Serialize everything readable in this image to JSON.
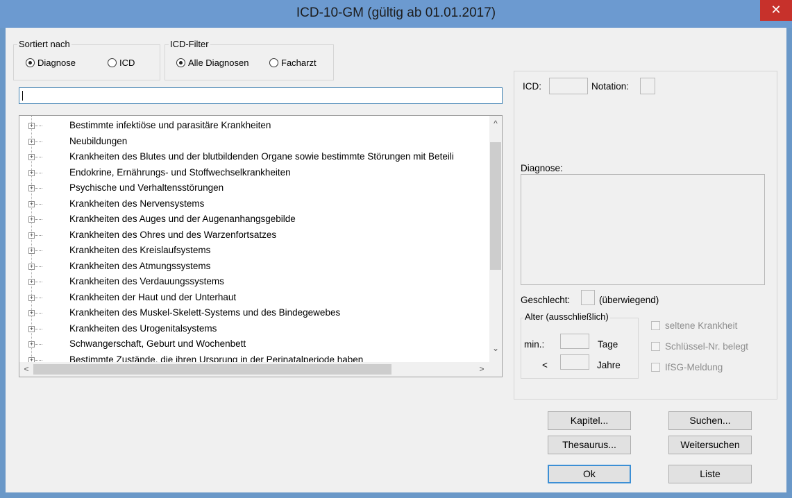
{
  "window": {
    "title": "ICD-10-GM (gültig ab 01.01.2017)",
    "close_glyph": "✕"
  },
  "sort": {
    "group_label": "Sortiert nach",
    "options": [
      {
        "label": "Diagnose",
        "selected": true
      },
      {
        "label": "ICD",
        "selected": false
      }
    ]
  },
  "filter": {
    "group_label": "ICD-Filter",
    "options": [
      {
        "label": "Alle Diagnosen",
        "selected": true
      },
      {
        "label": "Facharzt",
        "selected": false
      }
    ]
  },
  "search": {
    "value": ""
  },
  "tree": {
    "items": [
      "Bestimmte infektiöse und parasitäre Krankheiten",
      "Neubildungen",
      "Krankheiten des Blutes und der blutbildenden Organe sowie bestimmte Störungen mit Beteili",
      "Endokrine, Ernährungs- und Stoffwechselkrankheiten",
      "Psychische und Verhaltensstörungen",
      "Krankheiten des Nervensystems",
      "Krankheiten des Auges und der Augenanhangsgebilde",
      "Krankheiten des Ohres und des Warzenfortsatzes",
      "Krankheiten des Kreislaufsystems",
      "Krankheiten des Atmungssystems",
      "Krankheiten des Verdauungssystems",
      "Krankheiten der Haut und der Unterhaut",
      "Krankheiten des Muskel-Skelett-Systems und des Bindegewebes",
      "Krankheiten des Urogenitalsystems",
      "Schwangerschaft, Geburt und Wochenbett",
      "Bestimmte Zustände, die ihren Ursprung in der Perinatalperiode haben"
    ],
    "scroll_up": "^",
    "scroll_down": "⌄",
    "scroll_left": "<",
    "scroll_right": ">"
  },
  "details": {
    "icd_label": "ICD:",
    "notation_label": "Notation:",
    "diagnose_label": "Diagnose:",
    "geschlecht_label": "Geschlecht:",
    "geschlecht_suffix": "(überwiegend)",
    "alter_group_label": "Alter (ausschließlich)",
    "min_label": "min.:",
    "tage_label": "Tage",
    "lt_label": "<",
    "jahre_label": "Jahre",
    "checkboxes": [
      "seltene Krankheit",
      "Schlüssel-Nr. belegt",
      "IfSG-Meldung"
    ]
  },
  "buttons": {
    "kapitel": "Kapitel...",
    "suchen": "Suchen...",
    "thesaurus": "Thesaurus...",
    "weitersuchen": "Weitersuchen",
    "ok": "Ok",
    "liste": "Liste"
  }
}
